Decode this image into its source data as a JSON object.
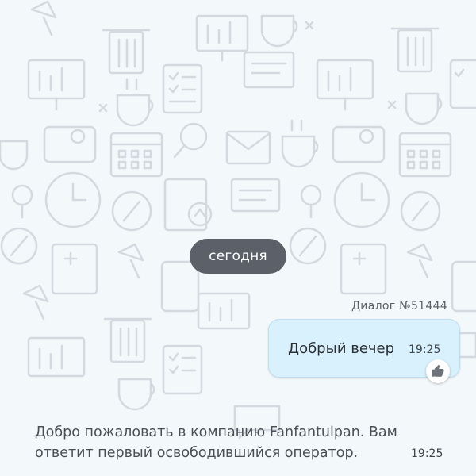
{
  "chat": {
    "date_separator": "сегодня",
    "dialog_label": "Диалог №51444",
    "outgoing_message": {
      "text": "Добрый вечер",
      "time": "19:25",
      "reaction_icon": "thumbs-up-icon"
    },
    "incoming_message": {
      "text": "Добро пожаловать в компанию Fanfantulpan. Вам ответит первый освободившийся оператор.",
      "time": "19:25"
    }
  },
  "colors": {
    "background": "#f3f8fa",
    "pattern": "#d3dadf",
    "date_pill": "#5c6068",
    "outgoing_bubble": "#d8f1fd"
  }
}
